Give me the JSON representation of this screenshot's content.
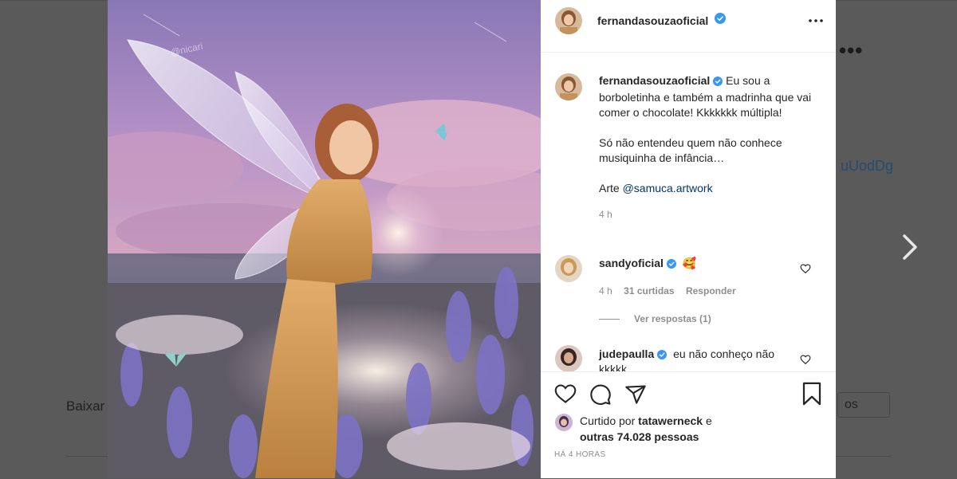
{
  "background": {
    "dots": "•••",
    "code_fragment": "uUodDg",
    "download_label": "Baixar",
    "input_fragment": "os"
  },
  "photo": {
    "watermark": "@nicari",
    "description_colors": {
      "sky": "#b694c7",
      "flowers": "#7b73c2",
      "dress": "#d9a25a"
    }
  },
  "header": {
    "username": "fernandasouzaoficial",
    "verified": true
  },
  "caption": {
    "username": "fernandasouzaoficial",
    "lines": [
      "Eu sou a borboletinha e também a madrinha que vai comer o chocolate! Kkkkkkk múltipla!",
      "Só não entendeu quem não conhece musiquinha de infância…"
    ],
    "credit_prefix": "Arte ",
    "credit_mention": "@samuca.artwork",
    "time": "4 h"
  },
  "comments": [
    {
      "username": "sandyoficial",
      "text": "🥰",
      "time": "4 h",
      "likes": "31 curtidas",
      "reply": "Responder",
      "view_replies": "Ver respostas (1)"
    },
    {
      "username": "judepaulla",
      "text": "eu não conheço não",
      "partial": "kkkkk"
    }
  ],
  "likes": {
    "prefix": "Curtido por ",
    "user": "tatawerneck",
    "middle": " e",
    "others": "outras 74.028 pessoas"
  },
  "timestamp": "HÁ 4 HORAS",
  "colors": {
    "verified": "#3897f0",
    "text": "#262626",
    "muted": "#8e8e8e",
    "link": "#00376b"
  }
}
